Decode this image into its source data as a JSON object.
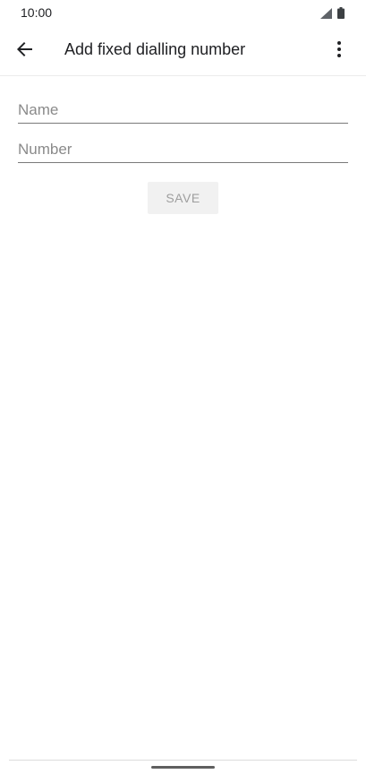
{
  "status_bar": {
    "time": "10:00",
    "icons": [
      "signal-icon",
      "battery-icon"
    ]
  },
  "app_bar": {
    "title": "Add fixed dialling number",
    "back_icon": "arrow-back-icon",
    "overflow_icon": "more-vert-icon"
  },
  "form": {
    "name_field": {
      "value": "",
      "placeholder": "Name"
    },
    "number_field": {
      "value": "",
      "placeholder": "Number"
    },
    "save_label": "SAVE"
  },
  "colors": {
    "background": "#ffffff",
    "text_primary": "#202124",
    "placeholder": "#8a8a8a",
    "button_bg": "#f1f1f1",
    "button_text_disabled": "#9e9e9e"
  }
}
